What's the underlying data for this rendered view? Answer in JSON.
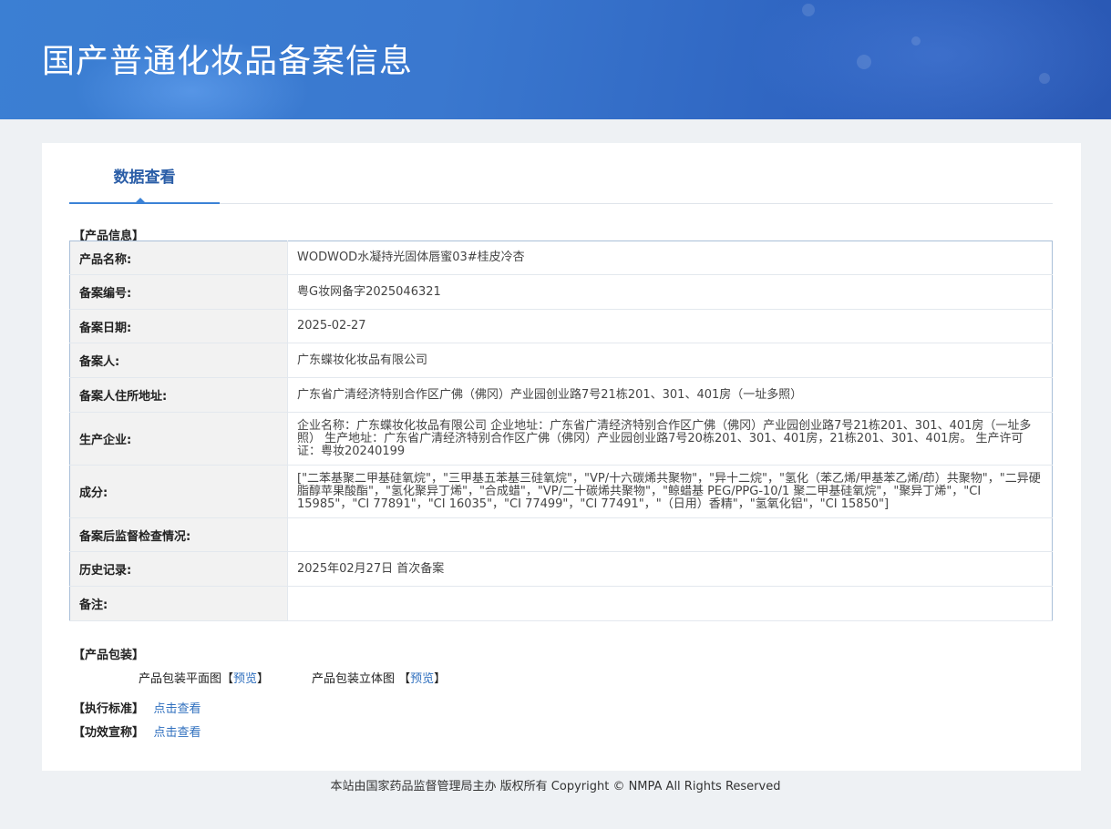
{
  "banner": {
    "title": "国产普通化妆品备案信息"
  },
  "tab": {
    "label": "数据查看"
  },
  "product_info": {
    "heading": "【产品信息】",
    "rows": [
      {
        "label": "产品名称:",
        "value": "WODWOD水凝持光固体唇蜜03#桂皮冷杏"
      },
      {
        "label": "备案编号:",
        "value": "粤G妆网备字2025046321"
      },
      {
        "label": "备案日期:",
        "value": "2025-02-27"
      },
      {
        "label": "备案人:",
        "value": "广东蝶妆化妆品有限公司"
      },
      {
        "label": "备案人住所地址:",
        "value": "广东省广清经济特别合作区广佛（佛冈）产业园创业路7号21栋201、301、401房（一址多照）"
      },
      {
        "label": "生产企业:",
        "value": "企业名称：广东蝶妆化妆品有限公司 企业地址：广东省广清经济特别合作区广佛（佛冈）产业园创业路7号21栋201、301、401房（一址多照） 生产地址：广东省广清经济特别合作区广佛（佛冈）产业园创业路7号20栋201、301、401房，21栋201、301、401房。 生产许可证：粤妆20240199"
      },
      {
        "label": "成分:",
        "value": "[\"二苯基聚二甲基硅氧烷\"，\"三甲基五苯基三硅氧烷\"，\"VP/十六碳烯共聚物\"，\"异十二烷\"，\"氢化（苯乙烯/甲基苯乙烯/茚）共聚物\"，\"二异硬脂醇苹果酸酯\"，\"氢化聚异丁烯\"，\"合成蜡\"，\"VP/二十碳烯共聚物\"，\"鲸蜡基 PEG/PPG-10/1 聚二甲基硅氧烷\"，\"聚异丁烯\"，\"CI 15985\"，\"CI 77891\"，\"CI 16035\"，\"CI 77499\"，\"CI 77491\"，\"（日用）香精\"，\"氢氧化铝\"，\"CI 15850\"]"
      },
      {
        "label": "备案后监督检查情况:",
        "value": ""
      },
      {
        "label": "历史记录:",
        "value": "2025年02月27日 首次备案"
      },
      {
        "label": "备注:",
        "value": ""
      }
    ]
  },
  "packaging": {
    "heading": "【产品包装】",
    "flat_label": "产品包装平面图",
    "flat_open": "【",
    "flat_link": "预览",
    "flat_close": "】",
    "solid_label": "产品包装立体图 ",
    "solid_open": "【",
    "solid_link": "预览",
    "solid_close": "】"
  },
  "standard": {
    "heading": "【执行标准】",
    "link": "点击查看"
  },
  "efficacy": {
    "heading": "【功效宣称】",
    "link": "点击查看"
  },
  "footer": {
    "text": "本站由国家药品监督管理局主办 版权所有 Copyright © NMPA All Rights Reserved"
  }
}
